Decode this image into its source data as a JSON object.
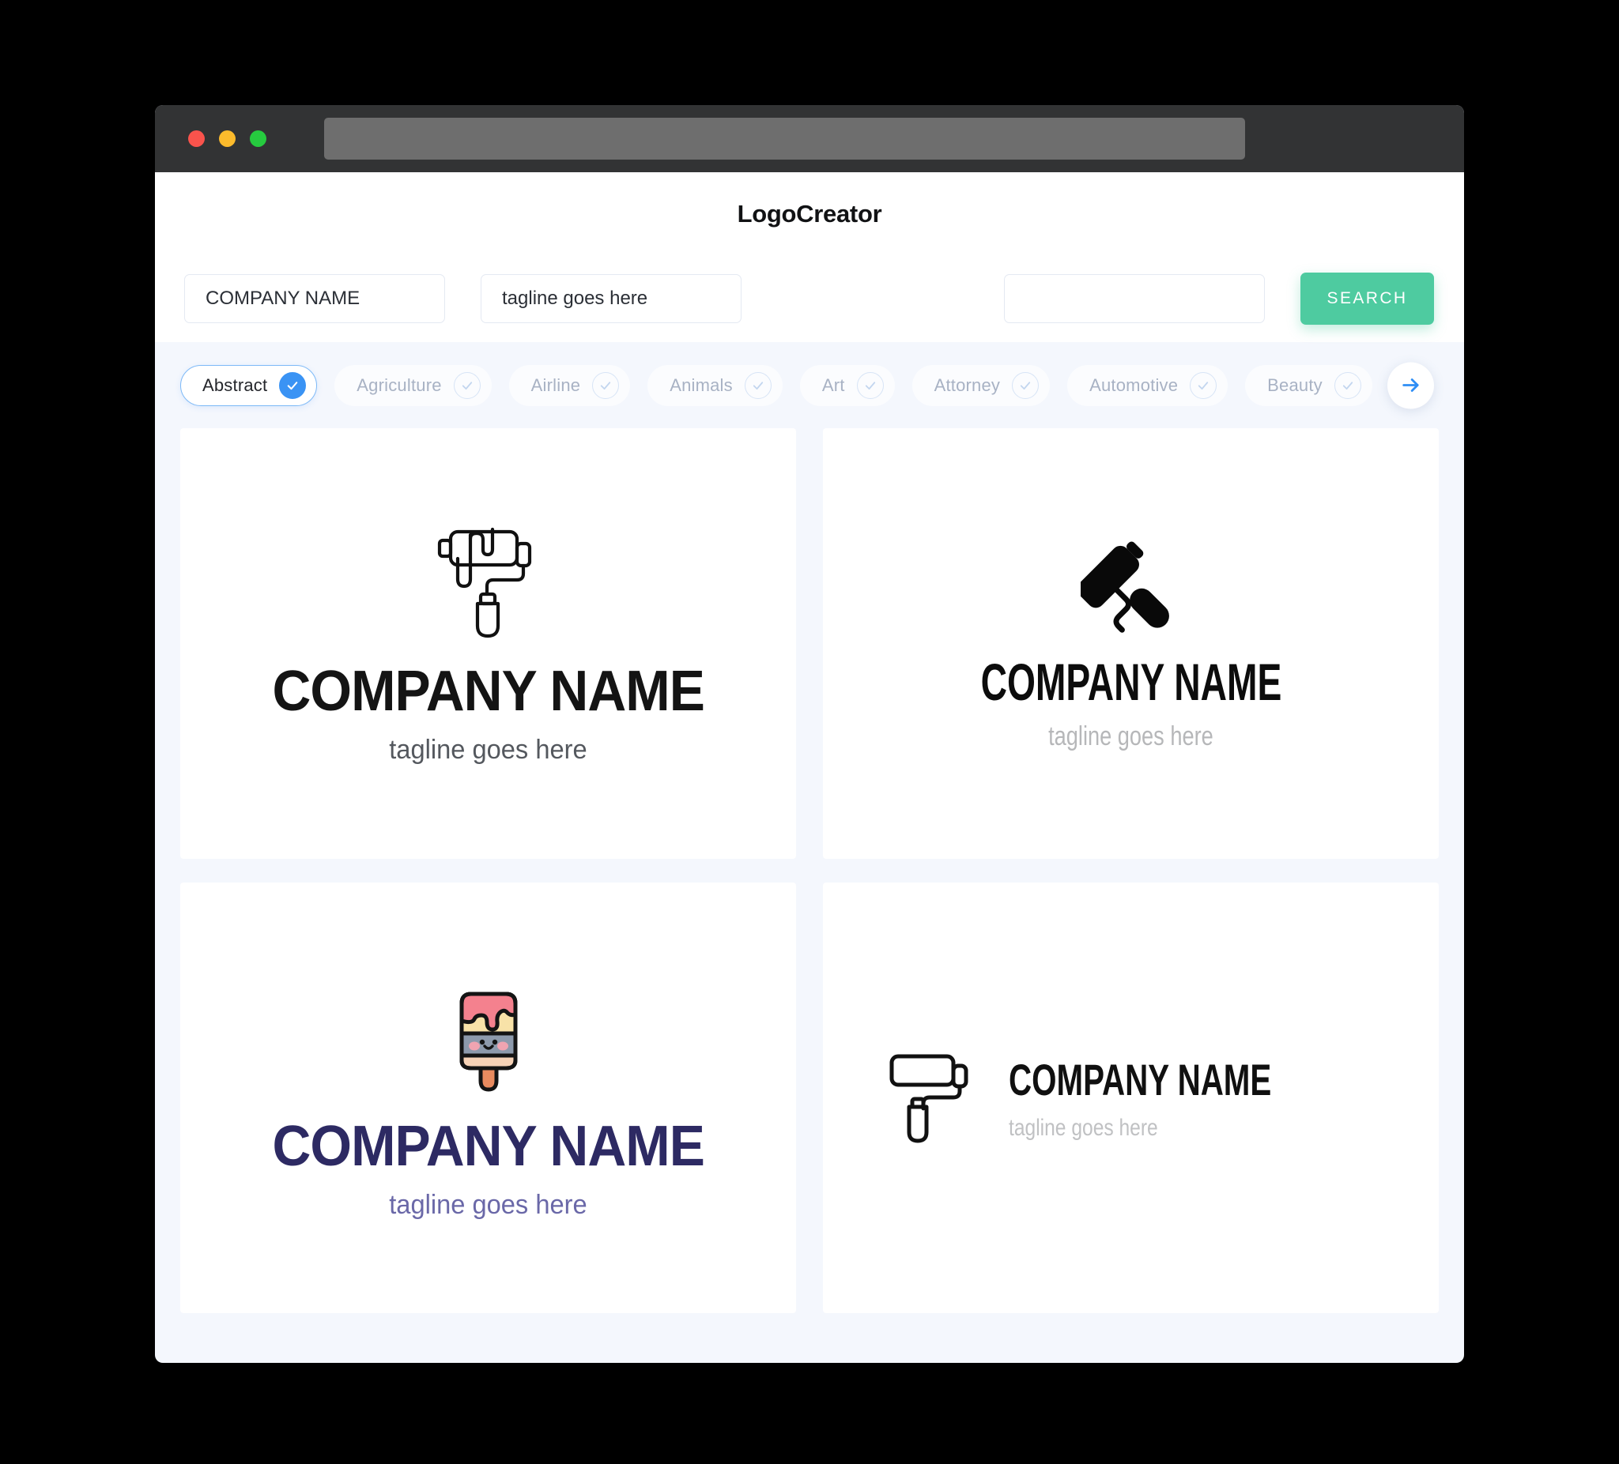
{
  "window": {
    "traffic_lights": [
      "close",
      "minimize",
      "maximize"
    ],
    "url_bar_value": ""
  },
  "header": {
    "app_title": "LogoCreator"
  },
  "search": {
    "company_name_value": "COMPANY NAME",
    "company_name_placeholder": "COMPANY NAME",
    "tagline_value": "tagline goes here",
    "tagline_placeholder": "tagline goes here",
    "keyword_value": "",
    "keyword_placeholder": "",
    "search_button_label": "SEARCH"
  },
  "categories": {
    "next_icon": "arrow-right-icon",
    "items": [
      {
        "label": "Abstract",
        "selected": true
      },
      {
        "label": "Agriculture",
        "selected": false
      },
      {
        "label": "Airline",
        "selected": false
      },
      {
        "label": "Animals",
        "selected": false
      },
      {
        "label": "Art",
        "selected": false
      },
      {
        "label": "Attorney",
        "selected": false
      },
      {
        "label": "Automotive",
        "selected": false
      },
      {
        "label": "Beauty",
        "selected": false
      }
    ]
  },
  "logos": [
    {
      "icon": "paint-roller-outline-icon",
      "company_name": "COMPANY NAME",
      "tagline": "tagline goes here",
      "layout": "stacked",
      "name_color": "#141414",
      "tagline_color": "#54585e"
    },
    {
      "icon": "paint-roller-solid-tilted-icon",
      "company_name": "COMPANY NAME",
      "tagline": "tagline goes here",
      "layout": "stacked",
      "name_color": "#0c0c0c",
      "tagline_color": "#b6b7b9"
    },
    {
      "icon": "kawaii-paintbrush-icon",
      "company_name": "COMPANY NAME",
      "tagline": "tagline goes here",
      "layout": "stacked",
      "name_color": "#2d2a63",
      "tagline_color": "#6a68a8"
    },
    {
      "icon": "paint-roller-outline-icon",
      "company_name": "COMPANY NAME",
      "tagline": "tagline goes here",
      "layout": "horizontal",
      "name_color": "#101010",
      "tagline_color": "#c0c1c3"
    }
  ],
  "colors": {
    "accent_green": "#4ecba0",
    "accent_blue": "#3a93f4",
    "page_background": "#f4f7fd",
    "titlebar": "#323334",
    "navy": "#2d2a63"
  }
}
